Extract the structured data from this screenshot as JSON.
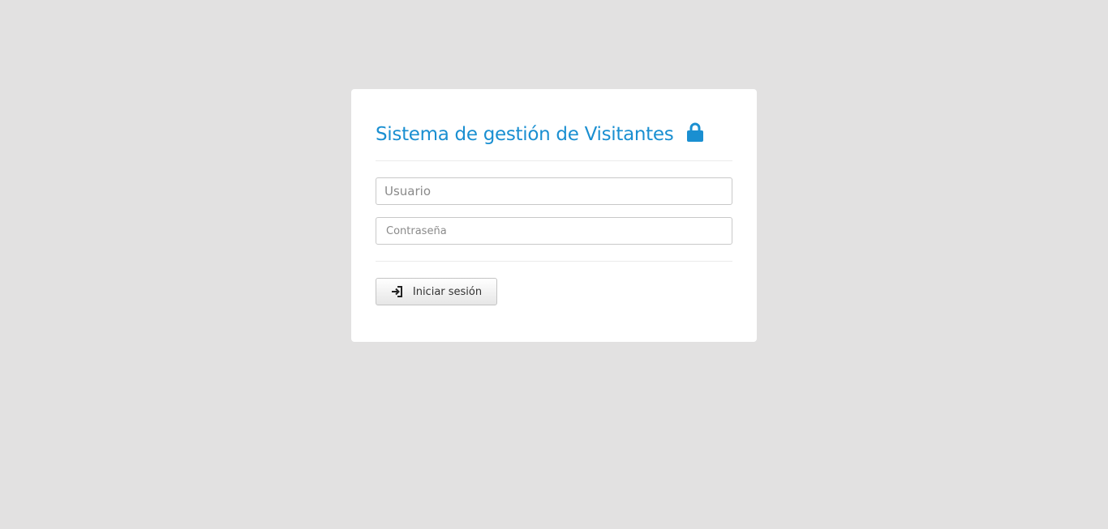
{
  "login": {
    "title": "Sistema de gestión de Visitantes",
    "title_icon": "lock-icon",
    "username": {
      "placeholder": "Usuario",
      "value": ""
    },
    "password": {
      "placeholder": "Contraseña",
      "value": ""
    },
    "submit": {
      "label": "Iniciar sesión",
      "icon": "sign-in-icon"
    }
  },
  "colors": {
    "background": "#e2e1e1",
    "card": "#ffffff",
    "accent": "#1a8fd1"
  }
}
